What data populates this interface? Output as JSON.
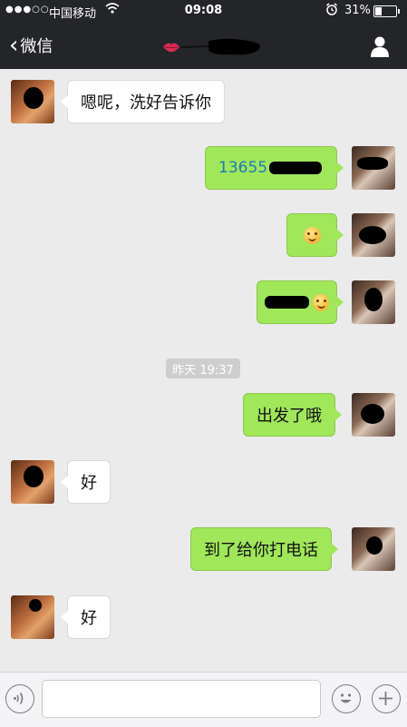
{
  "status_bar": {
    "carrier": "中国移动",
    "time": "09:08",
    "battery": "31%"
  },
  "nav": {
    "back_label": "微信"
  },
  "timestamp": "昨天 19:37",
  "messages": [
    {
      "side": "in",
      "text": "嗯呢，洗好告诉你"
    },
    {
      "side": "out",
      "text": "13655"
    },
    {
      "side": "out",
      "text": "",
      "emoji": "smile"
    },
    {
      "side": "out",
      "text": "",
      "emoji": "smile"
    },
    {
      "side": "out",
      "text": "出发了哦"
    },
    {
      "side": "in",
      "text": "好"
    },
    {
      "side": "out",
      "text": "到了给你打电话"
    },
    {
      "side": "in",
      "text": "好"
    }
  ],
  "icons": [
    "signal-dots-icon",
    "wifi-icon",
    "alarm-icon",
    "battery-icon",
    "back-chevron-icon",
    "lips-icon",
    "profile-icon",
    "voice-icon",
    "emoji-icon",
    "plus-icon"
  ],
  "colors": {
    "header": "#242529",
    "background": "#ebebeb",
    "outgoing_bubble": "#a0e75a",
    "incoming_bubble": "#ffffff",
    "link": "#1f7bb6"
  }
}
